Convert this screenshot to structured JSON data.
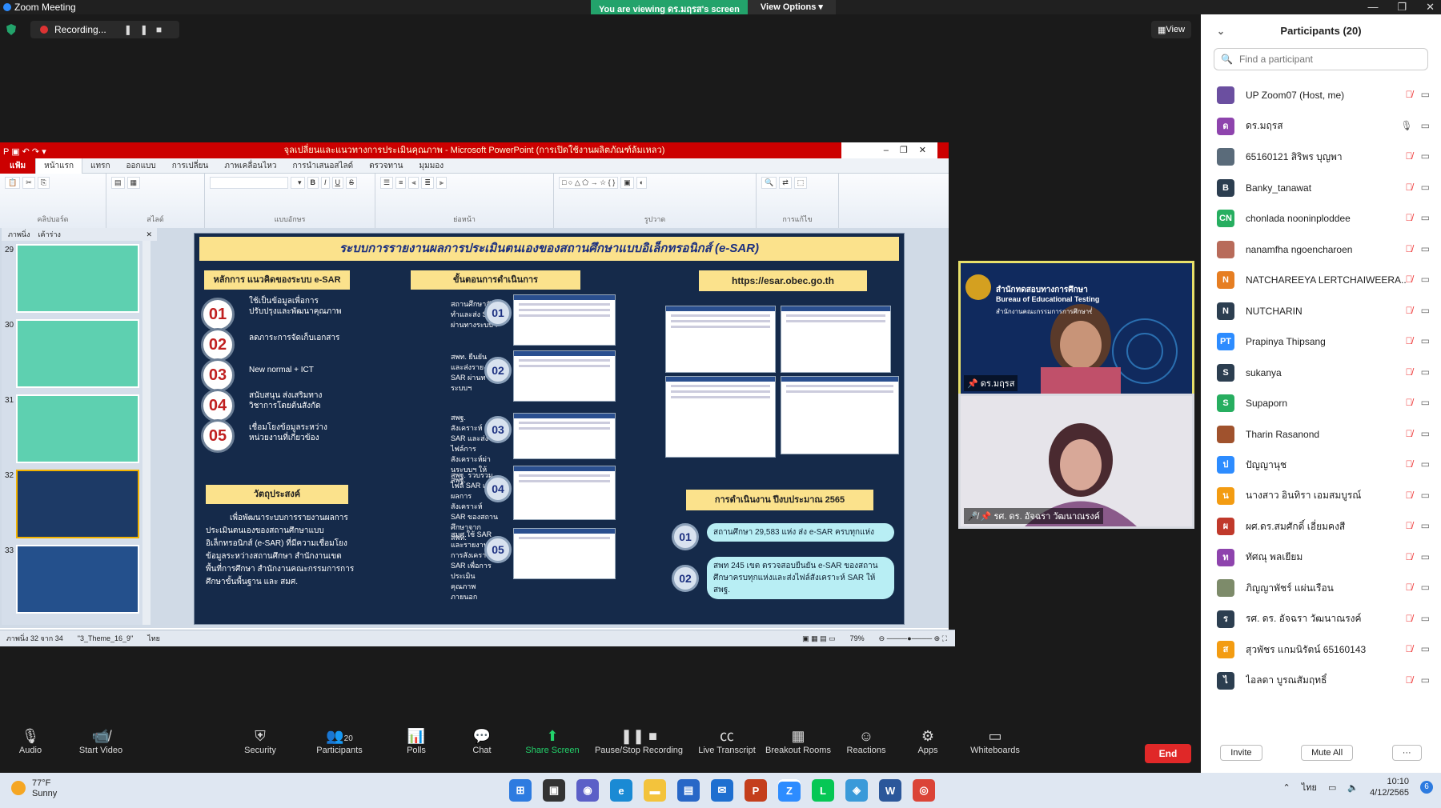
{
  "window": {
    "title": "Zoom Meeting",
    "share_banner": "You are viewing ดร.มฤรส's screen",
    "view_options": "View Options",
    "view_btn": "View"
  },
  "recording": {
    "label": "Recording..."
  },
  "ppt": {
    "title": "จุลเปลี่ยนและแนวทางการประเมินคุณภาพ - Microsoft PowerPoint (การเปิดใช้งานผลิตภัณฑ์ล้มเหลว)",
    "tabs": [
      "แฟ้ม",
      "หน้าแรก",
      "แทรก",
      "ออกแบบ",
      "การเปลี่ยน",
      "ภาพเคลื่อนไหว",
      "การนำเสนอสไลด์",
      "ตรวจทาน",
      "มุมมอง"
    ],
    "ribbon_groups": [
      "คลิปบอร์ด",
      "สไลด์",
      "แบบอักษร",
      "ย่อหน้า",
      "รูปวาด",
      "การแก้ไข"
    ],
    "thumb_tabs": [
      "ภาพนิ่ง",
      "เค้าร่าง"
    ],
    "thumb_numbers": [
      "29",
      "30",
      "31",
      "32",
      "33"
    ],
    "status": {
      "slide": "ภาพนิ่ง 32 จาก 34",
      "theme": "\"3_Theme_16_9\"",
      "lang": "ไทย",
      "zoom": "79%"
    },
    "slide": {
      "title": "ระบบการรายงานผลการประเมินตนเองของสถานศึกษาแบบอิเล็กทรอนิกส์ (e-SAR)",
      "col1_header": "หลักการ แนวคิดของระบบ e-SAR",
      "col2_header": "ขั้นตอนการดำเนินการ",
      "col3_header": "https://esar.obec.go.th",
      "principles": [
        {
          "n": "01",
          "t": "ใช้เป็นข้อมูลเพื่อการปรับปรุงและพัฒนาคุณภาพ"
        },
        {
          "n": "02",
          "t": "ลดภาระการจัดเก็บเอกสาร"
        },
        {
          "n": "03",
          "t": "New normal + ICT"
        },
        {
          "n": "04",
          "t": "สนับสนุน ส่งเสริมทางวิชาการโดยต้นสังกัด"
        },
        {
          "n": "05",
          "t": "เชื่อมโยงข้อมูลระหว่างหน่วยงานที่เกี่ยวข้อง"
        }
      ],
      "objective_header": "วัตถุประสงค์",
      "objective_text": "เพื่อพัฒนาระบบการรายงานผลการประเมินตนเองของสถานศึกษาแบบอิเล็กทรอนิกส์ (e-SAR) ที่มีความเชื่อมโยงข้อมูลระหว่างสถานศึกษา สำนักงานเขตพื้นที่การศึกษา สำนักงานคณะกรรมการการศึกษาขั้นพื้นฐาน และ สมศ.",
      "steps": [
        {
          "n": "01",
          "t": "สถานศึกษาจัดทำและส่ง SAR ผ่านทางระบบฯ"
        },
        {
          "n": "02",
          "t": "สพท. ยืนยันและส่งรายงาน SAR ผ่านทางระบบฯ"
        },
        {
          "n": "03",
          "t": "สพฐ. สังเคราะห์ SAR และส่งไฟล์การสังเคราะห์ผ่านระบบฯ ให้ สพฐ."
        },
        {
          "n": "04",
          "t": "สพฐ. รวบรวมไฟล์ SAR และผลการสังเคราะห์ SAR ของสถานศึกษาจาก สพท."
        },
        {
          "n": "05",
          "t": "สมศ.ใช้ SAR และรายงานการสังเคราะห์ SAR เพื่อการประเมินคุณภาพภายนอก"
        }
      ],
      "ops_header": "การดำเนินงาน ปีงบประมาณ 2565",
      "ops": [
        {
          "n": "01",
          "t": "สถานศึกษา 29,583 แห่ง ส่ง e-SAR ครบทุกแห่ง"
        },
        {
          "n": "02",
          "t": "สพท 245 เขต ตรวจสอบยืนยัน e-SAR ของสถานศึกษาครบทุกแห่งและส่งไฟล์สังเคราะห์ SAR ให้ สพฐ."
        }
      ]
    }
  },
  "videos": [
    {
      "name": "ดร.มฤรส",
      "org1": "สำนักทดสอบทางการศึกษา",
      "org2": "Bureau of Educational Testing",
      "org3": "สำนักงานคณะกรรมการการศึกษาขั้นพื้นฐาน"
    },
    {
      "name": "รศ. ดร. อัจฉรา วัฒนาณรงค์"
    }
  ],
  "panel": {
    "title": "Participants (20)",
    "search_placeholder": "Find a participant",
    "participants": [
      {
        "name": "UP Zoom07 (Host, me)",
        "initial": "",
        "color": "#6b4fa0"
      },
      {
        "name": "ดร.มฤรส",
        "initial": "ด",
        "color": "#8e44ad"
      },
      {
        "name": "65160121 สิริพร บุญพา",
        "initial": "",
        "color": "#5a6b7a"
      },
      {
        "name": "Banky_tanawat",
        "initial": "B",
        "color": "#2c3e50"
      },
      {
        "name": "chonlada nooninploddee",
        "initial": "CN",
        "color": "#27ae60"
      },
      {
        "name": "nanamfha ngoencharoen",
        "initial": "",
        "color": "#b86b5a"
      },
      {
        "name": "NATCHAREEYA LERTCHAIWEERA...",
        "initial": "N",
        "color": "#e67e22"
      },
      {
        "name": "NUTCHARIN",
        "initial": "N",
        "color": "#2c3e50"
      },
      {
        "name": "Prapinya Thipsang",
        "initial": "PT",
        "color": "#2d8cff"
      },
      {
        "name": "sukanya",
        "initial": "S",
        "color": "#2c3e50"
      },
      {
        "name": "Supaporn",
        "initial": "S",
        "color": "#27ae60"
      },
      {
        "name": "Tharin Rasanond",
        "initial": "",
        "color": "#a0522d"
      },
      {
        "name": "ปัญญานุช",
        "initial": "ป",
        "color": "#2d8cff"
      },
      {
        "name": "นางสาว อินทิรา เอมสมบูรณ์",
        "initial": "น",
        "color": "#f39c12"
      },
      {
        "name": "ผศ.ดร.สมศักดิ์ เอี่ยมคงสี",
        "initial": "ผ",
        "color": "#c0392b"
      },
      {
        "name": "ทัศณุ พลเยียม",
        "initial": "ท",
        "color": "#8e44ad"
      },
      {
        "name": "ภิญญาพัชร์ แผ่นเรือน",
        "initial": "",
        "color": "#7d8b6a"
      },
      {
        "name": "รศ. ดร. อัจฉรา วัฒนาณรงค์",
        "initial": "ร",
        "color": "#2c3e50"
      },
      {
        "name": "สุวพัชร แกมนิรัตน์ 65160143",
        "initial": "ส",
        "color": "#f39c12"
      },
      {
        "name": "ไอลดา บูรณสัมฤทธิ์",
        "initial": "ไ",
        "color": "#2c3e50"
      }
    ],
    "invite": "Invite",
    "mute_all": "Mute All",
    "more": "···"
  },
  "toolbar": {
    "audio": "Audio",
    "start_video": "Start Video",
    "security": "Security",
    "participants": "Participants",
    "participants_count": "20",
    "polls": "Polls",
    "chat": "Chat",
    "share_screen": "Share Screen",
    "pause_stop": "Pause/Stop Recording",
    "live_transcript": "Live Transcript",
    "breakout": "Breakout Rooms",
    "reactions": "Reactions",
    "apps": "Apps",
    "whiteboards": "Whiteboards",
    "end": "End"
  },
  "taskbar": {
    "temp": "77°F",
    "weather": "Sunny",
    "lang": "ไทย",
    "time": "10:10",
    "date": "4/12/2565",
    "notif": "6"
  }
}
